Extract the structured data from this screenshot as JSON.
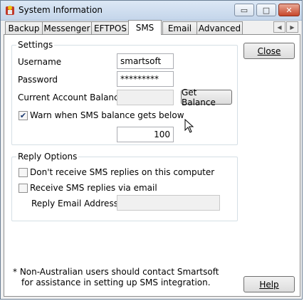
{
  "window": {
    "title": "System Information",
    "minimize_glyph": "▭",
    "maximize_glyph": "□",
    "close_glyph": "✕"
  },
  "tabs": [
    {
      "label": "Backup",
      "active": false
    },
    {
      "label": "Messenger",
      "active": false
    },
    {
      "label": "EFTPOS",
      "active": false
    },
    {
      "label": "SMS",
      "active": true
    },
    {
      "label": "Email",
      "active": false
    },
    {
      "label": "Advanced",
      "active": false
    }
  ],
  "tab_scroll": {
    "left": "◀",
    "right": "▶"
  },
  "settings": {
    "group_label": "Settings",
    "username_label": "Username",
    "username_value": "smartsoft",
    "password_label": "Password",
    "password_value": "*********",
    "balance_label": "Current Account Balance",
    "balance_value": "",
    "get_balance_button": "Get Balance",
    "warn_label": "Warn when SMS balance gets below",
    "warn_checked": true,
    "warn_value": "100"
  },
  "reply_options": {
    "group_label": "Reply Options",
    "dont_receive_label": "Don't receive SMS replies on this computer",
    "dont_receive_checked": false,
    "via_email_label": "Receive SMS replies via email",
    "via_email_checked": false,
    "reply_email_label": "Reply Email Address",
    "reply_email_value": ""
  },
  "buttons": {
    "close_label": "Close",
    "help_label": "Help"
  },
  "footnote": {
    "line1": "*  Non-Australian users should contact Smartsoft",
    "line2": "for assistance in setting up SMS integration."
  },
  "colors": {
    "titlebar": "#c4d5ea",
    "close_button": "#c7472b",
    "check_mark": "#1c3a70"
  }
}
